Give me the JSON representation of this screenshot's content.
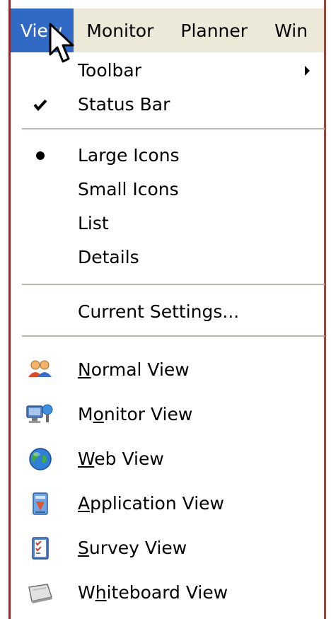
{
  "menubar": {
    "items": [
      "View",
      "Monitor",
      "Planner",
      "Win"
    ]
  },
  "menu": {
    "toolbar": "Toolbar",
    "status_bar": "Status Bar",
    "large_icons": "Large Icons",
    "small_icons": "Small Icons",
    "list": "List",
    "details": "Details",
    "current_settings": "Current Settings...",
    "normal_view": {
      "pre": "",
      "key": "N",
      "post": "ormal View"
    },
    "monitor_view": {
      "pre": "M",
      "key": "o",
      "post": "nitor View"
    },
    "web_view": {
      "pre": "",
      "key": "W",
      "post": "eb View"
    },
    "application_view": {
      "pre": "",
      "key": "A",
      "post": "pplication View"
    },
    "survey_view": {
      "pre": "",
      "key": "S",
      "post": "urvey View"
    },
    "whiteboard_view": {
      "pre": "W",
      "key": "h",
      "post": "iteboard View"
    }
  },
  "icons": {
    "checkmark": "checkmark-icon",
    "radio_dot": "radio-dot-icon",
    "submenu_arrow": "submenu-arrow-icon",
    "normal_view": "users-icon",
    "monitor_view": "monitor-view-icon",
    "web_view": "globe-icon",
    "application_view": "application-icon",
    "survey_view": "survey-checklist-icon",
    "whiteboard_view": "whiteboard-icon",
    "cursor": "mouse-cursor-icon"
  },
  "colors": {
    "menubar_bg": "#ece9d8",
    "active_menu_bg": "#316ac5",
    "separator": "#b9b6a8",
    "edge": "#8b2a2a"
  }
}
